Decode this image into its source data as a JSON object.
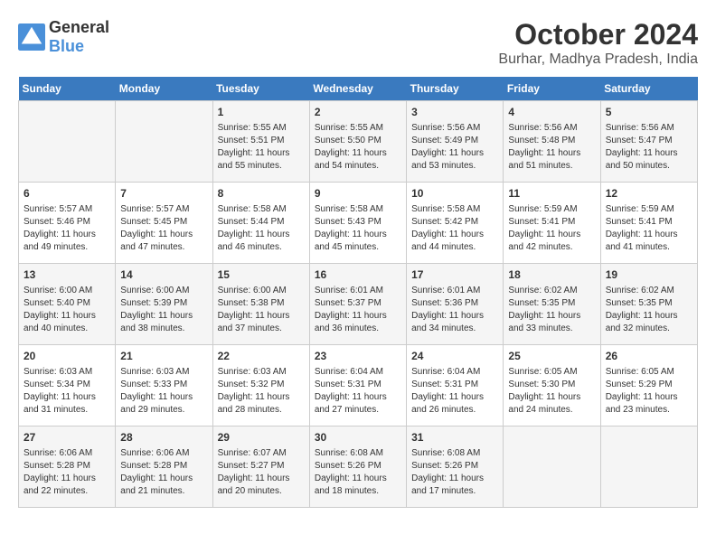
{
  "logo": {
    "general": "General",
    "blue": "Blue"
  },
  "title": "October 2024",
  "subtitle": "Burhar, Madhya Pradesh, India",
  "days_header": [
    "Sunday",
    "Monday",
    "Tuesday",
    "Wednesday",
    "Thursday",
    "Friday",
    "Saturday"
  ],
  "weeks": [
    [
      {
        "day": "",
        "content": ""
      },
      {
        "day": "",
        "content": ""
      },
      {
        "day": "1",
        "content": "Sunrise: 5:55 AM\nSunset: 5:51 PM\nDaylight: 11 hours and 55 minutes."
      },
      {
        "day": "2",
        "content": "Sunrise: 5:55 AM\nSunset: 5:50 PM\nDaylight: 11 hours and 54 minutes."
      },
      {
        "day": "3",
        "content": "Sunrise: 5:56 AM\nSunset: 5:49 PM\nDaylight: 11 hours and 53 minutes."
      },
      {
        "day": "4",
        "content": "Sunrise: 5:56 AM\nSunset: 5:48 PM\nDaylight: 11 hours and 51 minutes."
      },
      {
        "day": "5",
        "content": "Sunrise: 5:56 AM\nSunset: 5:47 PM\nDaylight: 11 hours and 50 minutes."
      }
    ],
    [
      {
        "day": "6",
        "content": "Sunrise: 5:57 AM\nSunset: 5:46 PM\nDaylight: 11 hours and 49 minutes."
      },
      {
        "day": "7",
        "content": "Sunrise: 5:57 AM\nSunset: 5:45 PM\nDaylight: 11 hours and 47 minutes."
      },
      {
        "day": "8",
        "content": "Sunrise: 5:58 AM\nSunset: 5:44 PM\nDaylight: 11 hours and 46 minutes."
      },
      {
        "day": "9",
        "content": "Sunrise: 5:58 AM\nSunset: 5:43 PM\nDaylight: 11 hours and 45 minutes."
      },
      {
        "day": "10",
        "content": "Sunrise: 5:58 AM\nSunset: 5:42 PM\nDaylight: 11 hours and 44 minutes."
      },
      {
        "day": "11",
        "content": "Sunrise: 5:59 AM\nSunset: 5:41 PM\nDaylight: 11 hours and 42 minutes."
      },
      {
        "day": "12",
        "content": "Sunrise: 5:59 AM\nSunset: 5:41 PM\nDaylight: 11 hours and 41 minutes."
      }
    ],
    [
      {
        "day": "13",
        "content": "Sunrise: 6:00 AM\nSunset: 5:40 PM\nDaylight: 11 hours and 40 minutes."
      },
      {
        "day": "14",
        "content": "Sunrise: 6:00 AM\nSunset: 5:39 PM\nDaylight: 11 hours and 38 minutes."
      },
      {
        "day": "15",
        "content": "Sunrise: 6:00 AM\nSunset: 5:38 PM\nDaylight: 11 hours and 37 minutes."
      },
      {
        "day": "16",
        "content": "Sunrise: 6:01 AM\nSunset: 5:37 PM\nDaylight: 11 hours and 36 minutes."
      },
      {
        "day": "17",
        "content": "Sunrise: 6:01 AM\nSunset: 5:36 PM\nDaylight: 11 hours and 34 minutes."
      },
      {
        "day": "18",
        "content": "Sunrise: 6:02 AM\nSunset: 5:35 PM\nDaylight: 11 hours and 33 minutes."
      },
      {
        "day": "19",
        "content": "Sunrise: 6:02 AM\nSunset: 5:35 PM\nDaylight: 11 hours and 32 minutes."
      }
    ],
    [
      {
        "day": "20",
        "content": "Sunrise: 6:03 AM\nSunset: 5:34 PM\nDaylight: 11 hours and 31 minutes."
      },
      {
        "day": "21",
        "content": "Sunrise: 6:03 AM\nSunset: 5:33 PM\nDaylight: 11 hours and 29 minutes."
      },
      {
        "day": "22",
        "content": "Sunrise: 6:03 AM\nSunset: 5:32 PM\nDaylight: 11 hours and 28 minutes."
      },
      {
        "day": "23",
        "content": "Sunrise: 6:04 AM\nSunset: 5:31 PM\nDaylight: 11 hours and 27 minutes."
      },
      {
        "day": "24",
        "content": "Sunrise: 6:04 AM\nSunset: 5:31 PM\nDaylight: 11 hours and 26 minutes."
      },
      {
        "day": "25",
        "content": "Sunrise: 6:05 AM\nSunset: 5:30 PM\nDaylight: 11 hours and 24 minutes."
      },
      {
        "day": "26",
        "content": "Sunrise: 6:05 AM\nSunset: 5:29 PM\nDaylight: 11 hours and 23 minutes."
      }
    ],
    [
      {
        "day": "27",
        "content": "Sunrise: 6:06 AM\nSunset: 5:28 PM\nDaylight: 11 hours and 22 minutes."
      },
      {
        "day": "28",
        "content": "Sunrise: 6:06 AM\nSunset: 5:28 PM\nDaylight: 11 hours and 21 minutes."
      },
      {
        "day": "29",
        "content": "Sunrise: 6:07 AM\nSunset: 5:27 PM\nDaylight: 11 hours and 20 minutes."
      },
      {
        "day": "30",
        "content": "Sunrise: 6:08 AM\nSunset: 5:26 PM\nDaylight: 11 hours and 18 minutes."
      },
      {
        "day": "31",
        "content": "Sunrise: 6:08 AM\nSunset: 5:26 PM\nDaylight: 11 hours and 17 minutes."
      },
      {
        "day": "",
        "content": ""
      },
      {
        "day": "",
        "content": ""
      }
    ]
  ]
}
